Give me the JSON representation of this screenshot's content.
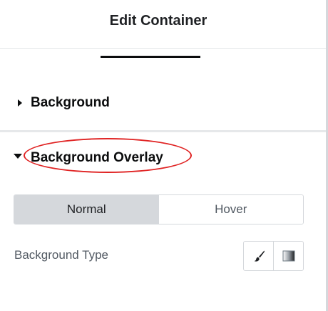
{
  "header": {
    "title": "Edit Container"
  },
  "sections": [
    {
      "label": "Background",
      "expanded": false
    },
    {
      "label": "Background Overlay",
      "expanded": true,
      "highlighted": true
    }
  ],
  "overlay": {
    "state_tabs": [
      {
        "label": "Normal",
        "active": true
      },
      {
        "label": "Hover",
        "active": false
      }
    ],
    "background_type": {
      "label": "Background Type",
      "options": [
        {
          "icon": "paint-brush-icon"
        },
        {
          "icon": "gradient-icon"
        }
      ]
    }
  },
  "colors": {
    "highlight": "#e02424",
    "active_tab": "#d5d8dc",
    "text": "#1f2124"
  }
}
